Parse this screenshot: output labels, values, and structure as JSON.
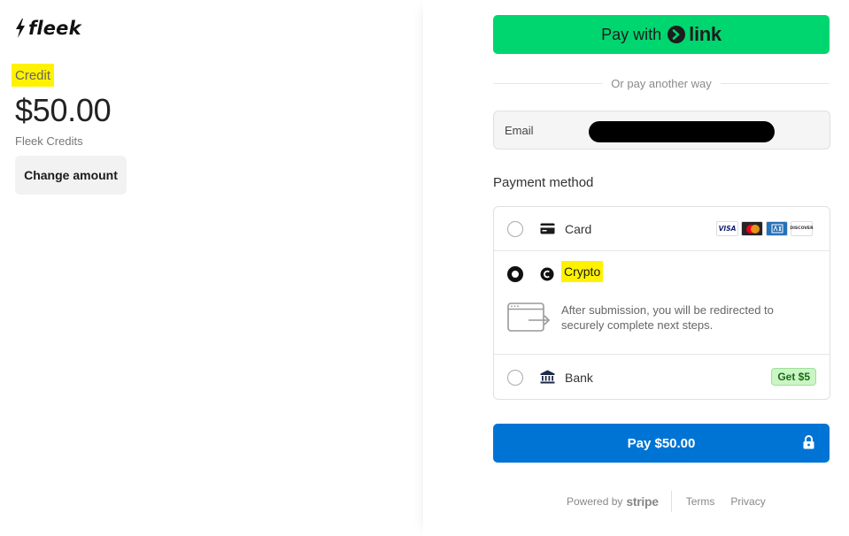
{
  "merchant": {
    "name": "fleek"
  },
  "product": {
    "name": "Credit",
    "price": "$50.00",
    "description": "Fleek Credits",
    "change_amount_label": "Change amount"
  },
  "checkout": {
    "link_button": {
      "prefix": "Pay with",
      "brand": "link"
    },
    "divider_text": "Or pay another way",
    "email": {
      "label": "Email",
      "value": ""
    },
    "payment_method_title": "Payment method",
    "methods": [
      {
        "label": "Card",
        "selected": false,
        "icon": "card-icon",
        "brands": [
          "VISA",
          "mastercard",
          "AMERICAN EXPRESS",
          "DISCOVER"
        ]
      },
      {
        "label": "Crypto",
        "selected": true,
        "icon": "crypto-coin-icon",
        "info": "After submission, you will be redirected to securely complete next steps."
      },
      {
        "label": "Bank",
        "selected": false,
        "icon": "bank-icon",
        "badge": "Get $5"
      }
    ],
    "pay_button_label": "Pay $50.00"
  },
  "footer": {
    "powered_by": "Powered by",
    "stripe": "stripe",
    "terms": "Terms",
    "privacy": "Privacy"
  },
  "colors": {
    "link_green": "#00d66f",
    "pay_blue": "#0074d4",
    "highlight_yellow": "#fff200",
    "badge_green": "#cbf5c4"
  }
}
